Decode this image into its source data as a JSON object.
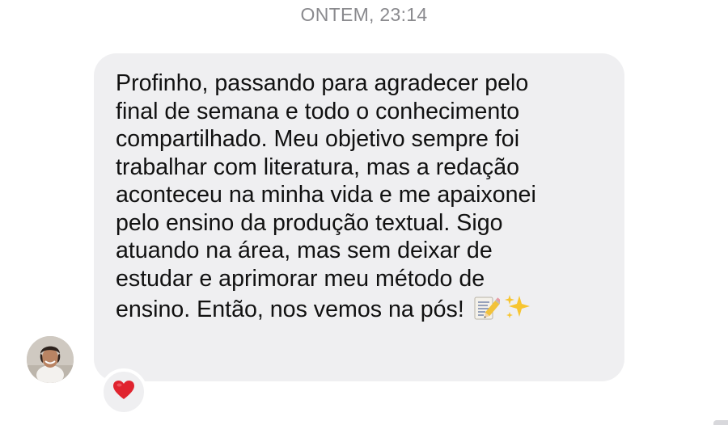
{
  "thread": {
    "timestamp": "ONTEM, 23:14"
  },
  "message": {
    "lines": [
      "Profinho, passando para agradecer pelo",
      "final de semana e todo o conhecimento",
      "compartilhado. Meu objetivo sempre foi",
      "trabalhar com literatura, mas a redação",
      "aconteceu na minha vida e me apaixonei",
      "pelo ensino da produção textual. Sigo",
      "atuando na área, mas sem deixar de",
      "estudar e aprimorar meu método de",
      "ensino. Então, nos vemos na pós!"
    ],
    "emojis": [
      "memo-icon",
      "sparkles-icon"
    ],
    "reaction": "heart-icon",
    "reaction_color": "#e0242f"
  },
  "colors": {
    "bubble": "#efeff1",
    "text": "#111111",
    "timestamp": "#8a8a8e"
  }
}
